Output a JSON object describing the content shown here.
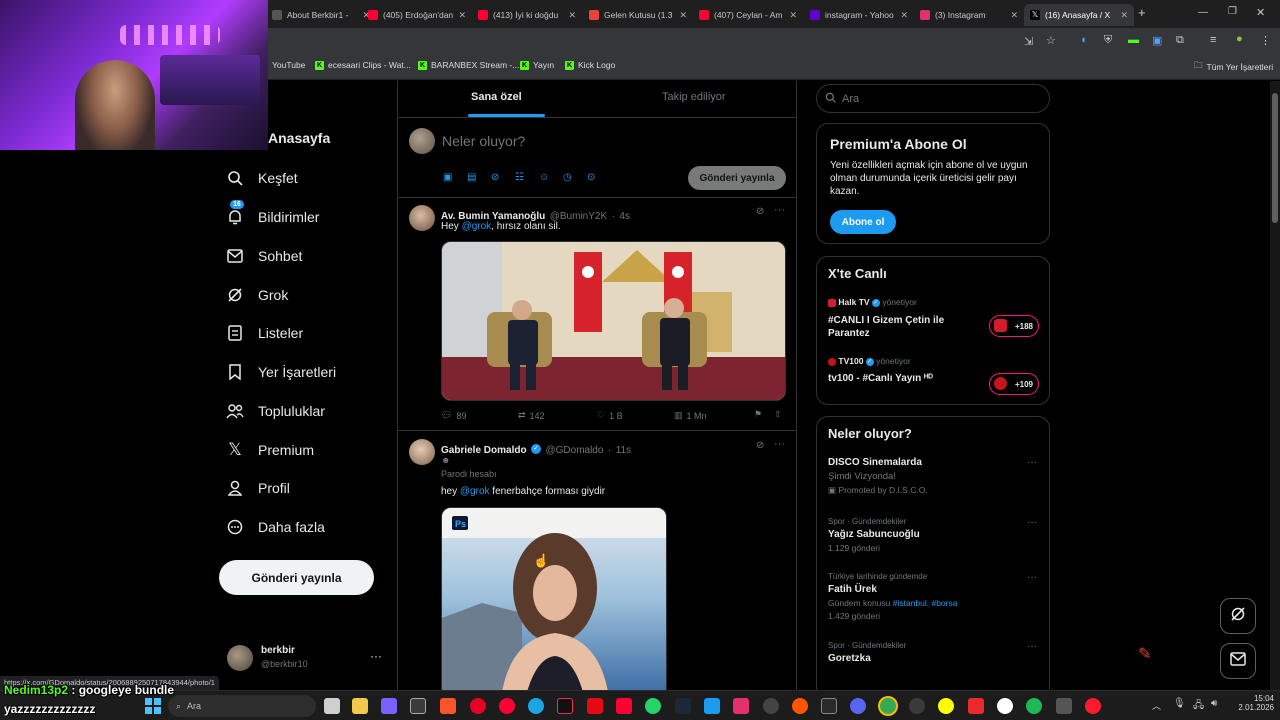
{
  "browser": {
    "tabs": [
      {
        "title": "About Berkbir1 - ",
        "color": "#555555"
      },
      {
        "title": "(405) Erdoğan'dan",
        "color": "#ff0033"
      },
      {
        "title": "(413) İyi ki doğdu",
        "color": "#ff0033"
      },
      {
        "title": "Gelen Kutusu (1.3",
        "color": "#ea4335"
      },
      {
        "title": "(407) Ceylan - Am",
        "color": "#ff0033"
      },
      {
        "title": "instagram - Yahoo",
        "color": "#6001d2"
      },
      {
        "title": "(3) Instagram",
        "color": "#e1306c"
      },
      {
        "title": "(16) Anasayfa / X",
        "color": "#ffffff"
      }
    ],
    "new_tab": "+",
    "bookmarks": [
      {
        "label": "YouTube",
        "color": "#ff0033"
      },
      {
        "label": "ecesaari Clips - Wat...",
        "color": "#53fc18"
      },
      {
        "label": "BARANBEX Stream -...",
        "color": "#53fc18"
      },
      {
        "label": "Yayın",
        "color": "#53fc18"
      },
      {
        "label": "Kick Logo",
        "color": "#53fc18"
      }
    ],
    "all_bookmarks": "Tüm Yer İşaretleri",
    "status_url": "https://x.com/GDomaldo/status/2006889250717843944/photo/1"
  },
  "nav": {
    "home": "Anasayfa",
    "items": [
      {
        "label": "Keşfet",
        "icon": "search-icon"
      },
      {
        "label": "Bildirimler",
        "icon": "bell-icon",
        "badge": "16"
      },
      {
        "label": "Sohbet",
        "icon": "mail-icon"
      },
      {
        "label": "Grok",
        "icon": "grok-icon"
      },
      {
        "label": "Listeler",
        "icon": "list-icon"
      },
      {
        "label": "Yer İşaretleri",
        "icon": "bookmark-icon"
      },
      {
        "label": "Topluluklar",
        "icon": "communities-icon"
      },
      {
        "label": "Premium",
        "icon": "x-logo-icon"
      },
      {
        "label": "Profil",
        "icon": "profile-icon"
      },
      {
        "label": "Daha fazla",
        "icon": "more-circle-icon"
      }
    ],
    "post_button": "Gönderi yayınla",
    "account": {
      "name": "berkbir",
      "handle": "@berkbir10"
    }
  },
  "feed": {
    "tabs": [
      "Sana özel",
      "Takip ediliyor"
    ],
    "composer": {
      "placeholder": "Neler oluyor?",
      "post_button": "Gönderi yayınla"
    },
    "tweets": [
      {
        "name": "Av. Bumin Yamanoğlu",
        "handle": "@BuminY2K",
        "time": "4s",
        "text_pre": "Hey ",
        "mention": "@grok",
        "text_post": ", hırsız olanı sil.",
        "stats": {
          "replies": "89",
          "reposts": "142",
          "likes": "1 B",
          "views": "1 Mn"
        }
      },
      {
        "name": "Gabriele Domaldo",
        "handle": "@GDomaldo",
        "time": "11s",
        "parody": "Parodi hesabı",
        "text_pre": "hey ",
        "mention": "@grok",
        "text_post": " fenerbahçe forması giydir"
      }
    ]
  },
  "right": {
    "search_placeholder": "Ara",
    "premium": {
      "title": "Premium'a Abone Ol",
      "body": "Yeni özellikleri açmak için abone ol ve uygun olman durumunda içerik üreticisi gelir payı kazan.",
      "button": "Abone ol"
    },
    "live": {
      "title": "X'te Canlı",
      "items": [
        {
          "host": "Halk TV",
          "role": "yönetiyor",
          "title": "#CANLI I Gizem Çetin ile Parantez",
          "count": "+188"
        },
        {
          "host": "TV100",
          "role": "yönetiyor",
          "title": "tv100 - #Canlı Yayın ᴴᴰ",
          "count": "+109"
        }
      ]
    },
    "trends": {
      "title": "Neler oluyor?",
      "items": [
        {
          "topic": "DISCO Sinemalarda",
          "sub": "Şimdi Vizyonda!",
          "promo": "Promoted by D.I.S.C.O."
        },
        {
          "meta": "Spor · Gündemdekiler",
          "topic": "Yağız Sabuncuoğlu",
          "sub": "1.129 gönderi"
        },
        {
          "meta": "Türkiye tarihinde gündemde",
          "topic": "Fatih Ürek",
          "sub_pre": "Gündem konusu ",
          "tags": "#istanbul, #borsa",
          "sub": "1.429 gönderi"
        },
        {
          "meta": "Spor · Gündemdekiler",
          "topic": "Goretzka"
        }
      ]
    }
  },
  "overlay": {
    "nick": "Nedim13p2",
    "message": " : googleye bundle",
    "line2": "yazzzzzzzzzzzzz"
  },
  "taskbar": {
    "search": "Ara",
    "time": "15:04",
    "date": "2.01.2026"
  }
}
